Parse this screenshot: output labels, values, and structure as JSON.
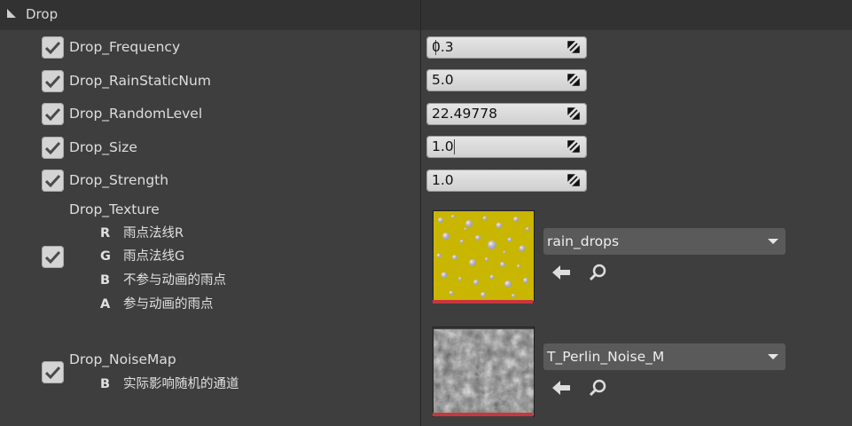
{
  "category": {
    "title": "Drop"
  },
  "properties": [
    {
      "label": "Drop_Frequency",
      "value": "0.3",
      "checked": true
    },
    {
      "label": "Drop_RainStaticNum",
      "value": "5.0",
      "checked": true
    },
    {
      "label": "Drop_RandomLevel",
      "value": "22.49778",
      "checked": true
    },
    {
      "label": "Drop_Size",
      "value": "1.0",
      "checked": true
    },
    {
      "label": "Drop_Strength",
      "value": "1.0",
      "checked": true
    }
  ],
  "texture": {
    "label": "Drop_Texture",
    "checked": true,
    "channels": [
      {
        "key": "R",
        "desc": "雨点法线R"
      },
      {
        "key": "G",
        "desc": "雨点法线G"
      },
      {
        "key": "B",
        "desc": "不参与动画的雨点"
      },
      {
        "key": "A",
        "desc": "参与动画的雨点"
      }
    ],
    "asset": "rain_drops"
  },
  "noise_map": {
    "label": "Drop_NoiseMap",
    "checked": true,
    "channels": [
      {
        "key": "B",
        "desc": "实际影响随机的通道"
      }
    ],
    "asset": "T_Perlin_Noise_M"
  },
  "icons": {
    "category_arrow": "collapse-triangle-icon",
    "checkbox": "checkmark-icon",
    "num_drag": "drag-resize-icon",
    "combo": "chevron-down-icon",
    "use_selected": "arrow-left-icon",
    "browse": "search-icon"
  },
  "colors": {
    "panel_bg": "#3e3e3e",
    "header_bg": "#323232",
    "thumb_bar": "#c8373d",
    "rain_texture": "#c8b400"
  }
}
